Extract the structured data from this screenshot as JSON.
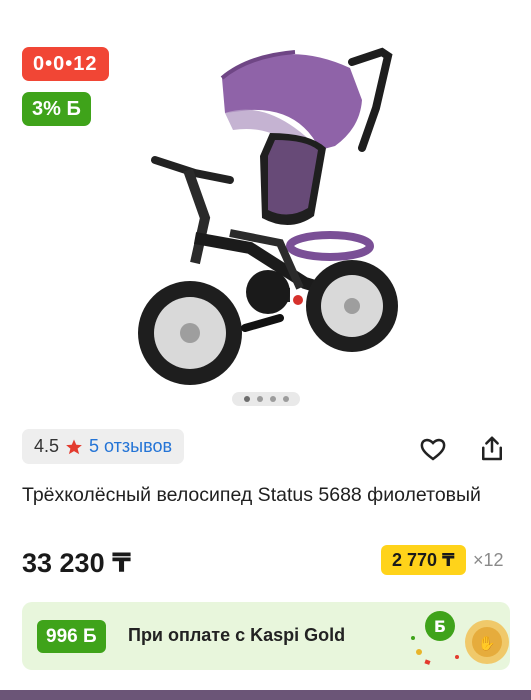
{
  "gallery": {
    "installment_badge": "0•0•12",
    "bonus_badge": "3% Б",
    "photo_alt": "product-photo",
    "dots_count": 4,
    "active_dot": 1
  },
  "rating": {
    "value": "4.5",
    "star_icon": "star-icon",
    "reviews": "5 отзывов"
  },
  "actions": {
    "favorite_icon": "heart-icon",
    "share_icon": "share-icon"
  },
  "product": {
    "title": "Трёхколёсный велосипед Status 5688 фиолетовый",
    "price": "33 230 ₸",
    "monthly_payment": "2 770 ₸",
    "months": "×12"
  },
  "kaspi_gold": {
    "bonus": "996 Б",
    "text": "При оплате с Kaspi Gold"
  },
  "colors": {
    "installment_red": "#f14635",
    "bonus_green": "#3fa31a",
    "link_blue": "#2474d6",
    "monthly_yellow": "#ffd31a",
    "gold_card_bg": "#e8f6dc"
  }
}
